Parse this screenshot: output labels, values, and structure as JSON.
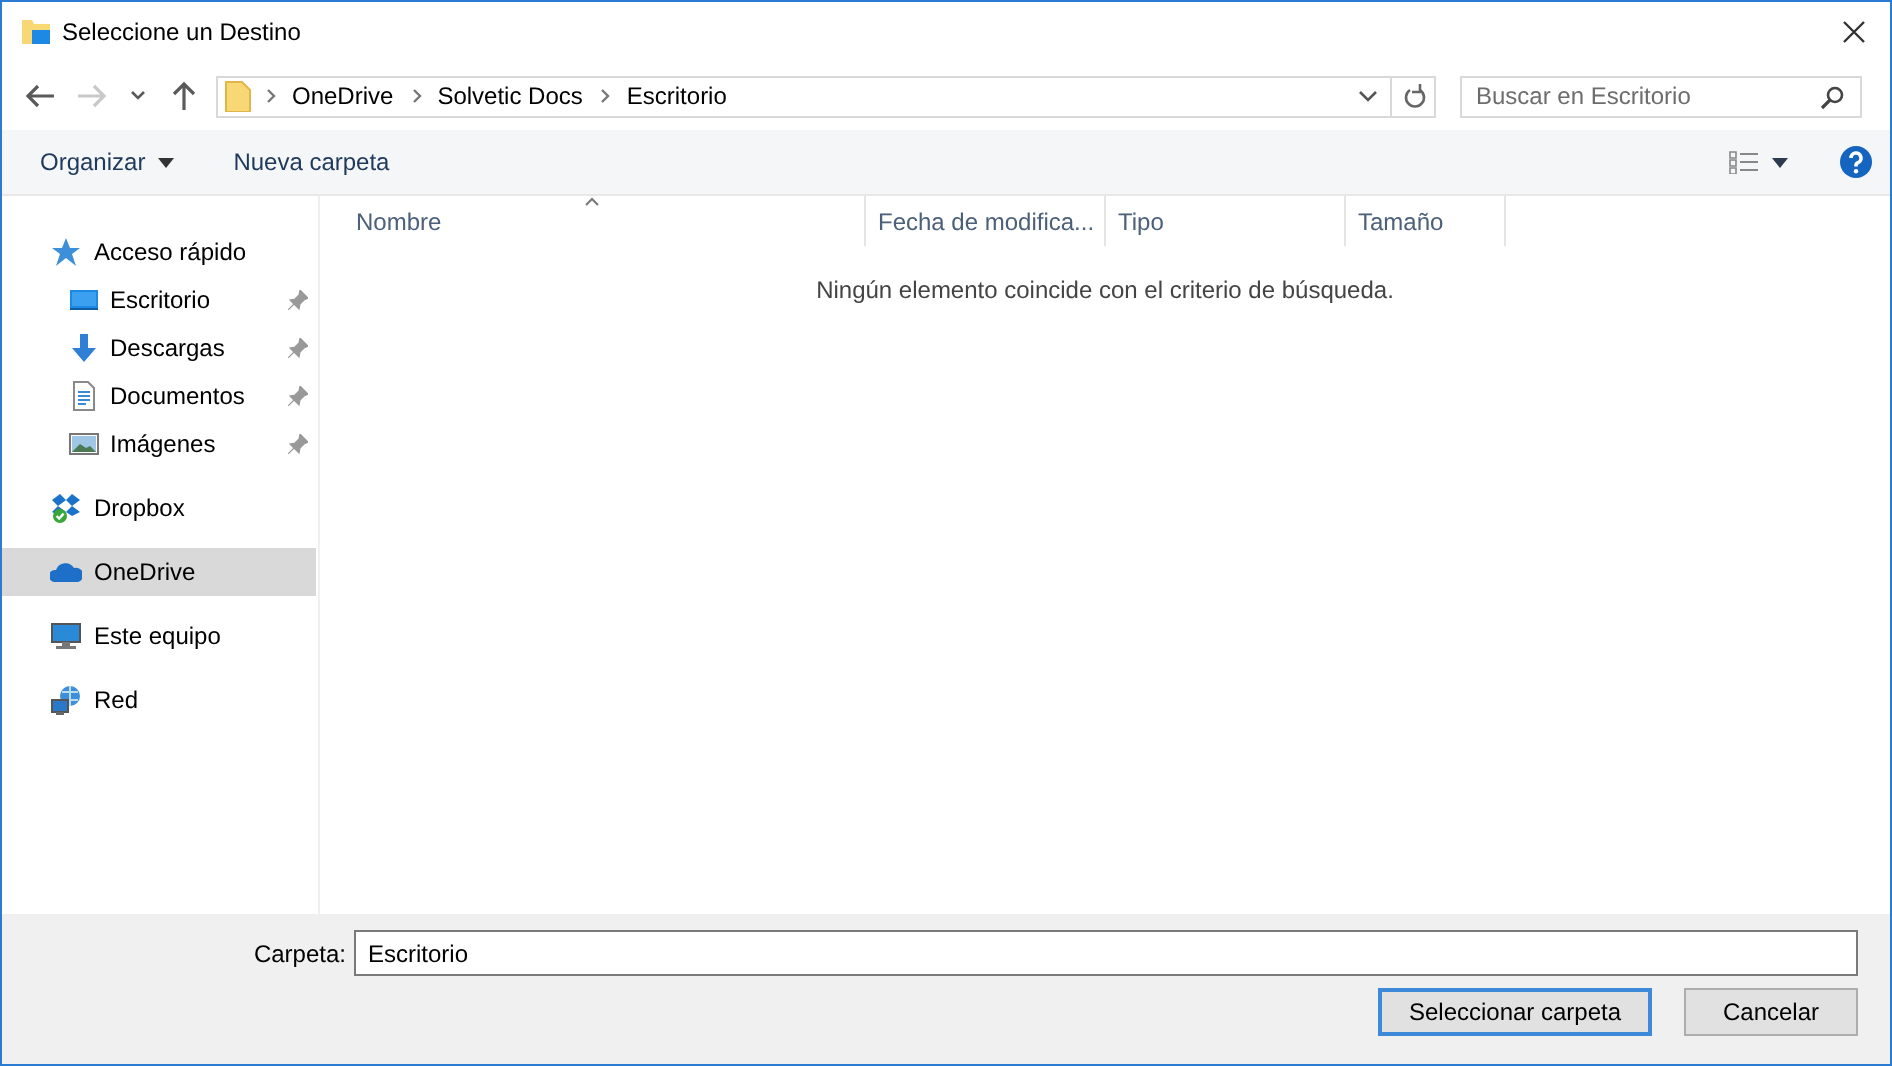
{
  "window": {
    "title": "Seleccione un Destino"
  },
  "nav_buttons": [
    {
      "kind": "back",
      "disabled": false
    },
    {
      "kind": "forward",
      "disabled": true
    },
    {
      "kind": "recent",
      "disabled": false
    },
    {
      "kind": "up",
      "disabled": false
    }
  ],
  "address": {
    "segments": [
      "OneDrive",
      "Solvetic Docs",
      "Escritorio"
    ]
  },
  "search": {
    "placeholder": "Buscar en Escritorio"
  },
  "toolbar": {
    "items": [
      {
        "label": "Organizar",
        "kind": "menu"
      },
      {
        "label": "Nueva carpeta",
        "kind": "button"
      }
    ]
  },
  "sidebar": {
    "items": [
      {
        "label": "Acceso rápido",
        "kind": "quick",
        "selected": false,
        "children": [
          {
            "label": "Escritorio",
            "kind": "desktop",
            "selected": false
          },
          {
            "label": "Descargas",
            "kind": "downloads",
            "selected": false
          },
          {
            "label": "Documentos",
            "kind": "documents",
            "selected": false
          },
          {
            "label": "Imágenes",
            "kind": "images",
            "selected": false
          }
        ]
      },
      {
        "label": "Dropbox",
        "kind": "dropbox",
        "selected": false
      },
      {
        "label": "OneDrive",
        "kind": "onedrive",
        "selected": true
      },
      {
        "label": "Este equipo",
        "kind": "computer",
        "selected": false
      },
      {
        "label": "Red",
        "kind": "network",
        "selected": false
      }
    ]
  },
  "file_list": {
    "columns": [
      {
        "label": "Nombre",
        "sorted": true
      },
      {
        "label": "Fecha de modifica...",
        "sorted": false
      },
      {
        "label": "Tipo",
        "sorted": false
      },
      {
        "label": "Tamaño",
        "sorted": false
      }
    ],
    "empty_message": "Ningún elemento coincide con el criterio de búsqueda."
  },
  "footer": {
    "folder_label": "Carpeta:",
    "folder_value": "Escritorio",
    "buttons": [
      {
        "label": "Seleccionar carpeta",
        "default": true
      },
      {
        "label": "Cancelar",
        "default": false
      }
    ]
  }
}
